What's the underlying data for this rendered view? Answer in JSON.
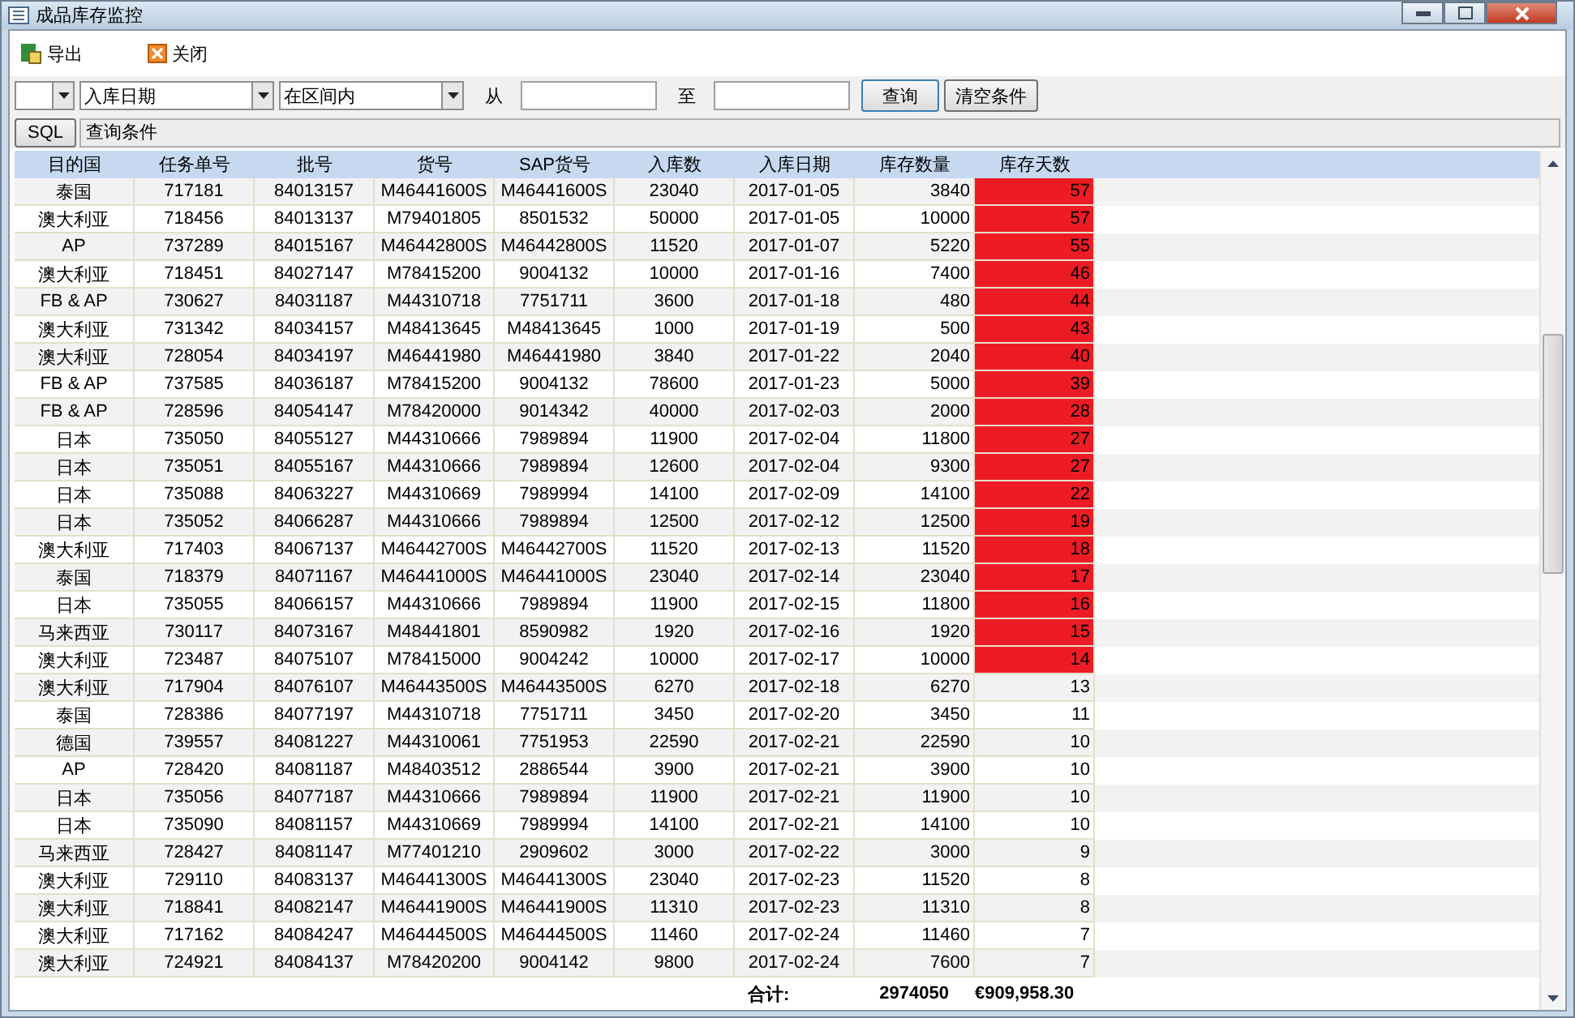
{
  "window": {
    "title": "成品库存监控"
  },
  "toolbar": [
    {
      "kind": "export",
      "label": "导出"
    },
    {
      "kind": "close",
      "label": "关闭"
    }
  ],
  "filter": {
    "field": "入库日期",
    "operator": "在区间内",
    "from_label": "从",
    "to_label": "至",
    "buttons": [
      "查询",
      "清空条件"
    ]
  },
  "sql": {
    "button": "SQL",
    "condition": "查询条件"
  },
  "table": {
    "columns": [
      "目的国",
      "任务单号",
      "批号",
      "货号",
      "SAP货号",
      "入库数",
      "入库日期",
      "库存数量",
      "库存天数"
    ],
    "rows": [
      {
        "cells": [
          "泰国",
          "717181",
          "84013157",
          "M46441600S",
          "M46441600S",
          "23040",
          "2017-01-05",
          "3840",
          "57"
        ],
        "alert": true
      },
      {
        "cells": [
          "澳大利亚",
          "718456",
          "84013137",
          "M79401805",
          "8501532",
          "50000",
          "2017-01-05",
          "10000",
          "57"
        ],
        "alert": true
      },
      {
        "cells": [
          "AP",
          "737289",
          "84015167",
          "M46442800S",
          "M46442800S",
          "11520",
          "2017-01-07",
          "5220",
          "55"
        ],
        "alert": true
      },
      {
        "cells": [
          "澳大利亚",
          "718451",
          "84027147",
          "M78415200",
          "9004132",
          "10000",
          "2017-01-16",
          "7400",
          "46"
        ],
        "alert": true
      },
      {
        "cells": [
          "FB & AP",
          "730627",
          "84031187",
          "M44310718",
          "7751711",
          "3600",
          "2017-01-18",
          "480",
          "44"
        ],
        "alert": true
      },
      {
        "cells": [
          "澳大利亚",
          "731342",
          "84034157",
          "M48413645",
          "M48413645",
          "1000",
          "2017-01-19",
          "500",
          "43"
        ],
        "alert": true
      },
      {
        "cells": [
          "澳大利亚",
          "728054",
          "84034197",
          "M46441980",
          "M46441980",
          "3840",
          "2017-01-22",
          "2040",
          "40"
        ],
        "alert": true
      },
      {
        "cells": [
          "FB & AP",
          "737585",
          "84036187",
          "M78415200",
          "9004132",
          "78600",
          "2017-01-23",
          "5000",
          "39"
        ],
        "alert": true
      },
      {
        "cells": [
          "FB & AP",
          "728596",
          "84054147",
          "M78420000",
          "9014342",
          "40000",
          "2017-02-03",
          "2000",
          "28"
        ],
        "alert": true
      },
      {
        "cells": [
          "日本",
          "735050",
          "84055127",
          "M44310666",
          "7989894",
          "11900",
          "2017-02-04",
          "11800",
          "27"
        ],
        "alert": true
      },
      {
        "cells": [
          "日本",
          "735051",
          "84055167",
          "M44310666",
          "7989894",
          "12600",
          "2017-02-04",
          "9300",
          "27"
        ],
        "alert": true
      },
      {
        "cells": [
          "日本",
          "735088",
          "84063227",
          "M44310669",
          "7989994",
          "14100",
          "2017-02-09",
          "14100",
          "22"
        ],
        "alert": true
      },
      {
        "cells": [
          "日本",
          "735052",
          "84066287",
          "M44310666",
          "7989894",
          "12500",
          "2017-02-12",
          "12500",
          "19"
        ],
        "alert": true
      },
      {
        "cells": [
          "澳大利亚",
          "717403",
          "84067137",
          "M46442700S",
          "M46442700S",
          "11520",
          "2017-02-13",
          "11520",
          "18"
        ],
        "alert": true
      },
      {
        "cells": [
          "泰国",
          "718379",
          "84071167",
          "M46441000S",
          "M46441000S",
          "23040",
          "2017-02-14",
          "23040",
          "17"
        ],
        "alert": true
      },
      {
        "cells": [
          "日本",
          "735055",
          "84066157",
          "M44310666",
          "7989894",
          "11900",
          "2017-02-15",
          "11800",
          "16"
        ],
        "alert": true
      },
      {
        "cells": [
          "马来西亚",
          "730117",
          "84073167",
          "M48441801",
          "8590982",
          "1920",
          "2017-02-16",
          "1920",
          "15"
        ],
        "alert": true
      },
      {
        "cells": [
          "澳大利亚",
          "723487",
          "84075107",
          "M78415000",
          "9004242",
          "10000",
          "2017-02-17",
          "10000",
          "14"
        ],
        "alert": true
      },
      {
        "cells": [
          "澳大利亚",
          "717904",
          "84076107",
          "M46443500S",
          "M46443500S",
          "6270",
          "2017-02-18",
          "6270",
          "13"
        ],
        "alert": false
      },
      {
        "cells": [
          "泰国",
          "728386",
          "84077197",
          "M44310718",
          "7751711",
          "3450",
          "2017-02-20",
          "3450",
          "11"
        ],
        "alert": false
      },
      {
        "cells": [
          "德国",
          "739557",
          "84081227",
          "M44310061",
          "7751953",
          "22590",
          "2017-02-21",
          "22590",
          "10"
        ],
        "alert": false
      },
      {
        "cells": [
          "AP",
          "728420",
          "84081187",
          "M48403512",
          "2886544",
          "3900",
          "2017-02-21",
          "3900",
          "10"
        ],
        "alert": false
      },
      {
        "cells": [
          "日本",
          "735056",
          "84077187",
          "M44310666",
          "7989894",
          "11900",
          "2017-02-21",
          "11900",
          "10"
        ],
        "alert": false
      },
      {
        "cells": [
          "日本",
          "735090",
          "84081157",
          "M44310669",
          "7989994",
          "14100",
          "2017-02-21",
          "14100",
          "10"
        ],
        "alert": false
      },
      {
        "cells": [
          "马来西亚",
          "728427",
          "84081147",
          "M77401210",
          "2909602",
          "3000",
          "2017-02-22",
          "3000",
          "9"
        ],
        "alert": false
      },
      {
        "cells": [
          "澳大利亚",
          "729110",
          "84083137",
          "M46441300S",
          "M46441300S",
          "23040",
          "2017-02-23",
          "11520",
          "8"
        ],
        "alert": false
      },
      {
        "cells": [
          "澳大利亚",
          "718841",
          "84082147",
          "M46441900S",
          "M46441900S",
          "11310",
          "2017-02-23",
          "11310",
          "8"
        ],
        "alert": false
      },
      {
        "cells": [
          "澳大利亚",
          "717162",
          "84084247",
          "M46444500S",
          "M46444500S",
          "11460",
          "2017-02-24",
          "11460",
          "7"
        ],
        "alert": false
      },
      {
        "cells": [
          "澳大利亚",
          "724921",
          "84084137",
          "M78420200",
          "9004142",
          "9800",
          "2017-02-24",
          "7600",
          "7"
        ],
        "alert": false
      }
    ],
    "totals": {
      "label": "合计:",
      "quantity": "2974050",
      "amount": "€909,958.30"
    }
  }
}
